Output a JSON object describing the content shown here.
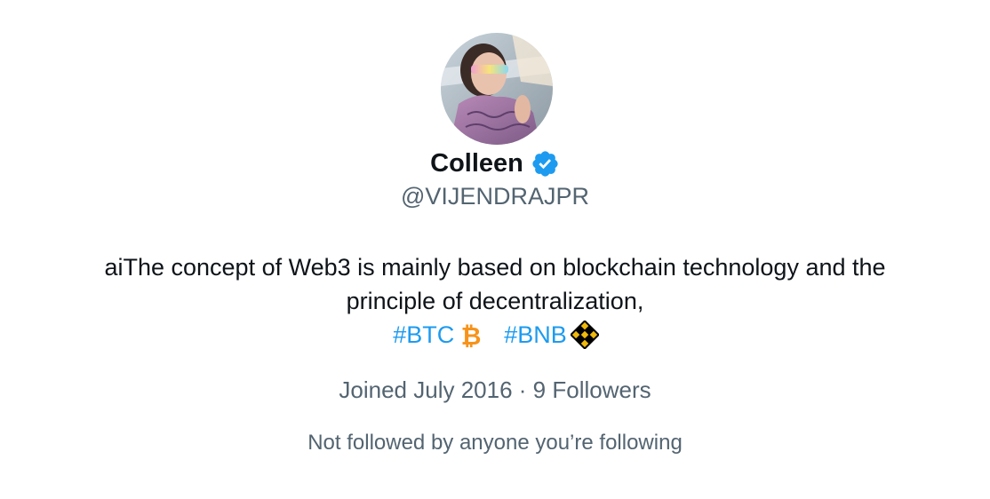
{
  "profile": {
    "display_name": "Colleen",
    "handle": "@VIJENDRAJPR",
    "verified_icon": "verified-badge-icon",
    "bio_line1": "aiThe concept of Web3 is mainly based on blockchain technology and the",
    "bio_line2": "principle of decentralization,",
    "hashtags": [
      {
        "label": "#BTC",
        "icon": "bitcoin-icon"
      },
      {
        "label": "#BNB",
        "icon": "binance-icon"
      }
    ],
    "joined": "Joined July 2016",
    "separator": "·",
    "followers": "9 Followers",
    "mutuals": "Not followed by anyone you’re following"
  },
  "colors": {
    "text_primary": "#0f1419",
    "text_secondary": "#536471",
    "link": "#1d9bf0",
    "verified": "#1d9bf0",
    "bitcoin": "#f7931a",
    "binance": "#f0b90b"
  }
}
